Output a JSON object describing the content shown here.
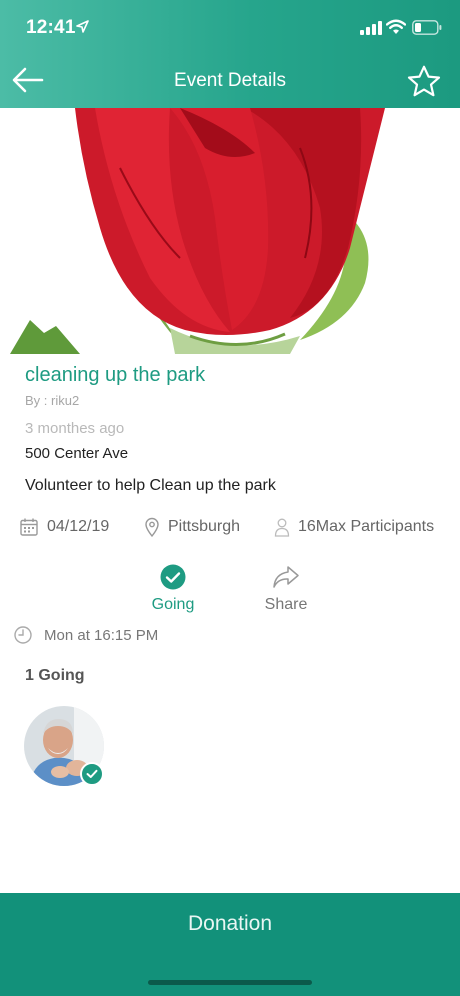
{
  "status_bar": {
    "time": "12:41",
    "icons": [
      "location-arrow-icon",
      "signal-bars-icon",
      "wifi-icon",
      "battery-icon"
    ]
  },
  "header": {
    "title": "Event Details",
    "back_icon": "arrow-left-icon",
    "favorite_icon": "star-outline-icon"
  },
  "event": {
    "title": "cleaning up the park",
    "by": "By : riku2",
    "posted_ago": "3 monthes ago",
    "address": "500 Center Ave",
    "description": "Volunteer to help Clean up the park",
    "date": "04/12/19",
    "location": "Pittsburgh",
    "participants": "16Max Participants",
    "time": "Mon at 16:15 PM",
    "going_count": "1 Going"
  },
  "actions": {
    "going_label": "Going",
    "share_label": "Share"
  },
  "footer": {
    "donation_label": "Donation"
  },
  "colors": {
    "accent": "#1e9b82",
    "header_gradient_start": "#4cbca6",
    "header_gradient_end": "#1c9a80",
    "footer": "#12917a"
  }
}
